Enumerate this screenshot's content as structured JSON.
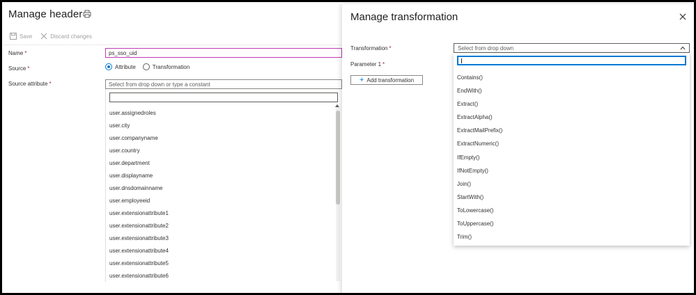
{
  "left_panel": {
    "title": "Manage header",
    "toolbar": {
      "save_label": "Save",
      "discard_label": "Discard changes"
    },
    "form": {
      "name_label": "Name",
      "name_value": "ps_sso_uid",
      "source_label": "Source",
      "source_options": [
        "Attribute",
        "Transformation"
      ],
      "source_selected": "Attribute",
      "source_attribute_label": "Source attribute",
      "source_attribute_placeholder": "Select from drop down or type a constant",
      "required_marker": "*"
    },
    "attribute_options": [
      "user.assignedroles",
      "user.city",
      "user.companyname",
      "user.country",
      "user.department",
      "user.displayname",
      "user.dnsdomainname",
      "user.employeeid",
      "user.extensionattribute1",
      "user.extensionattribute2",
      "user.extensionattribute3",
      "user.extensionattribute4",
      "user.extensionattribute5",
      "user.extensionattribute6"
    ]
  },
  "right_panel": {
    "title": "Manage transformation",
    "transformation_label": "Transformation",
    "transformation_placeholder": "Select from drop down",
    "parameter_label": "Parameter 1",
    "required_marker": "*",
    "add_button_label": "Add transformation",
    "transformation_options": [
      "Contains()",
      "EndWith()",
      "Extract()",
      "ExtractAlpha()",
      "ExtractMailPrefix()",
      "ExtractNumeric()",
      "IfEmpty()",
      "IfNotEmpty()",
      "Join()",
      "StartWith()",
      "ToLowercase()",
      "ToUppercase()",
      "Trim()"
    ]
  },
  "colors": {
    "accent": "#0078d4",
    "focus_border": "#c239b3",
    "required": "#a4262c"
  }
}
